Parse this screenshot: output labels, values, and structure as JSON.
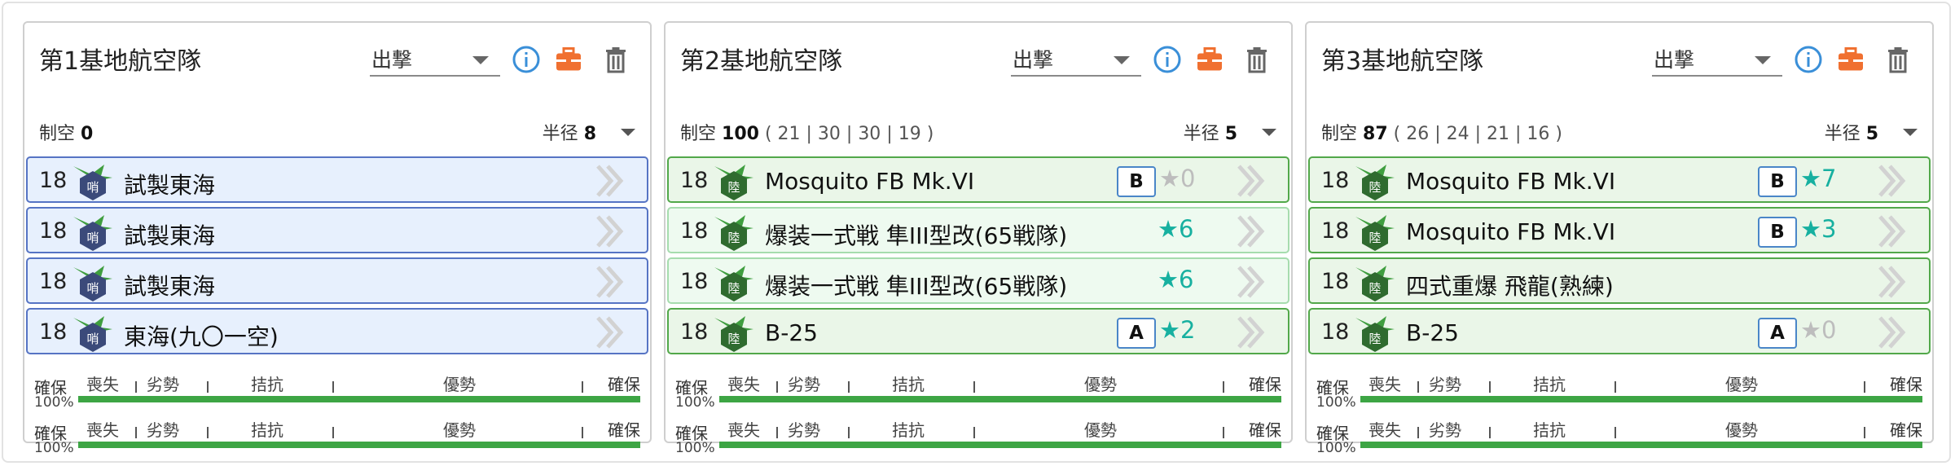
{
  "panels": [
    {
      "title": "第1基地航空隊",
      "mode": "出撃",
      "air_label": "制空",
      "air_value": "0",
      "air_breakdown": "",
      "radius_label": "半径",
      "radius_value": "8",
      "slots": [
        {
          "count": "18",
          "name": "試製東海",
          "badge": "哨",
          "prof": "",
          "star": ""
        },
        {
          "count": "18",
          "name": "試製東海",
          "badge": "哨",
          "prof": "",
          "star": ""
        },
        {
          "count": "18",
          "name": "試製東海",
          "badge": "哨",
          "prof": "",
          "star": ""
        },
        {
          "count": "18",
          "name": "東海(九〇一空)",
          "badge": "哨",
          "prof": "",
          "star": ""
        }
      ]
    },
    {
      "title": "第2基地航空隊",
      "mode": "出撃",
      "air_label": "制空",
      "air_value": "100",
      "air_breakdown": "( 21 | 30 | 30 | 19 )",
      "radius_label": "半径",
      "radius_value": "5",
      "slots": [
        {
          "count": "18",
          "name": "Mosquito FB Mk.VI",
          "badge": "陸",
          "prof": "B",
          "star": "★0"
        },
        {
          "count": "18",
          "name": "爆装一式戦 隼III型改(65戦隊)",
          "badge": "陸",
          "prof": "",
          "star": "★6"
        },
        {
          "count": "18",
          "name": "爆装一式戦 隼III型改(65戦隊)",
          "badge": "陸",
          "prof": "",
          "star": "★6"
        },
        {
          "count": "18",
          "name": "B-25",
          "badge": "陸",
          "prof": "A",
          "star": "★2"
        }
      ]
    },
    {
      "title": "第3基地航空隊",
      "mode": "出撃",
      "air_label": "制空",
      "air_value": "87",
      "air_breakdown": "( 26 | 24 | 21 | 16 )",
      "radius_label": "半径",
      "radius_value": "5",
      "slots": [
        {
          "count": "18",
          "name": "Mosquito FB Mk.VI",
          "badge": "陸",
          "prof": "B",
          "star": "★7"
        },
        {
          "count": "18",
          "name": "Mosquito FB Mk.VI",
          "badge": "陸",
          "prof": "B",
          "star": "★3"
        },
        {
          "count": "18",
          "name": "四式重爆 飛龍(熟練)",
          "badge": "陸",
          "prof": "",
          "star": ""
        },
        {
          "count": "18",
          "name": "B-25",
          "badge": "陸",
          "prof": "A",
          "star": "★0"
        }
      ]
    }
  ],
  "status_bar": {
    "left": "確保",
    "percent": "100%",
    "segments": [
      "喪失",
      "劣勢",
      "拮抗",
      "優勢"
    ],
    "right": "確保",
    "fill": 1.0
  },
  "colors": {
    "lb_slot_bg": "#e7f0fd",
    "ga_slot_bg": "#eaf6e8",
    "star_teal": "#17b0a0",
    "star_gray": "#bdbdbd",
    "bar_green": "#3da544",
    "info_blue": "#3a8fd8",
    "box_orange": "#f07030"
  }
}
